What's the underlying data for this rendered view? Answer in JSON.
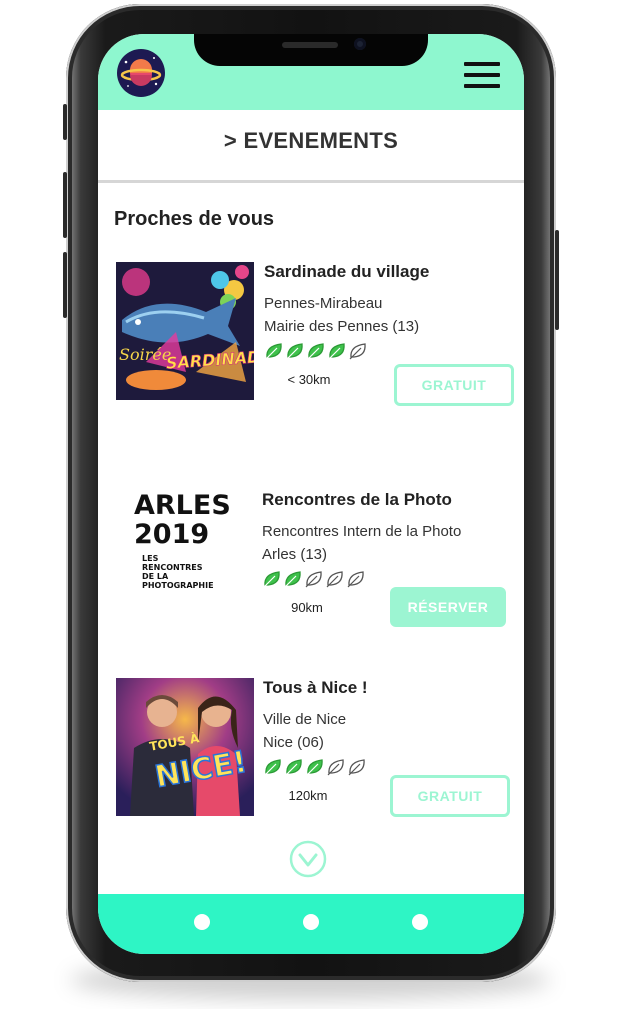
{
  "header": {
    "logo_icon": "planet-logo-icon",
    "menu_icon": "hamburger-menu-icon",
    "accent": "#8ef7cf"
  },
  "page_title": "> EVENEMENTS",
  "section_title": "Proches de vous",
  "events": [
    {
      "title": "Sardinade du village",
      "line1": "Pennes-Mirabeau",
      "line2": "Mairie des Pennes (13)",
      "rating": 4,
      "rating_max": 5,
      "distance": "< 30km",
      "cta": "GRATUIT",
      "cta_style": "outline",
      "thumb_text_1": "Soirée",
      "thumb_text_2": "SARDINADE"
    },
    {
      "title": "Rencontres de la Photo",
      "line1": "Rencontres Intern de la Photo",
      "line2": "Arles (13)",
      "rating": 2,
      "rating_max": 5,
      "distance": "90km",
      "cta": "RÉSERVER",
      "cta_style": "filled",
      "thumb_text_1": "ARLES",
      "thumb_text_2": "2019",
      "thumb_text_3": "LES",
      "thumb_text_4": "RENCONTRES",
      "thumb_text_5": "DE LA",
      "thumb_text_6": "PHOTOGRAPHIE"
    },
    {
      "title": "Tous à Nice !",
      "line1": "Ville de Nice",
      "line2": "Nice (06)",
      "rating": 3,
      "rating_max": 5,
      "distance": "120km",
      "cta": "GRATUIT",
      "cta_style": "outline",
      "thumb_text_1": "TOUS À",
      "thumb_text_2": "NICE!"
    }
  ],
  "scroll_icon": "chevron-down-circle-icon",
  "footer": {
    "dots": 3,
    "accent": "#2ef5c5"
  },
  "colors": {
    "leaf_full": "#3ec14b",
    "cta_green": "#9cf5d2"
  }
}
